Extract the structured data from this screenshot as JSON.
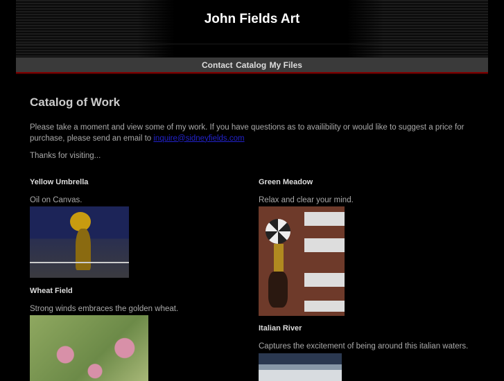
{
  "header": {
    "title": "John Fields Art"
  },
  "nav": {
    "links": [
      "Contact",
      "Catalog",
      "My Files"
    ]
  },
  "main": {
    "title": "Catalog of Work",
    "intro": "Please take a moment and view some of my work. If you have questions as to availibility or would like to suggest a price for purchase, please send an email to ",
    "email": "inquire@sidneyfields.com",
    "thanks": "Thanks for visiting...",
    "items": [
      {
        "title": "Yellow Umbrella",
        "desc": "Oil on Canvas."
      },
      {
        "title": "Green Meadow",
        "desc": "Relax and clear your mind."
      },
      {
        "title": "Wheat Field",
        "desc": "Strong winds embraces the golden wheat."
      },
      {
        "title": "Italian River",
        "desc": "Captures the excitement of being around this italian waters."
      }
    ]
  }
}
